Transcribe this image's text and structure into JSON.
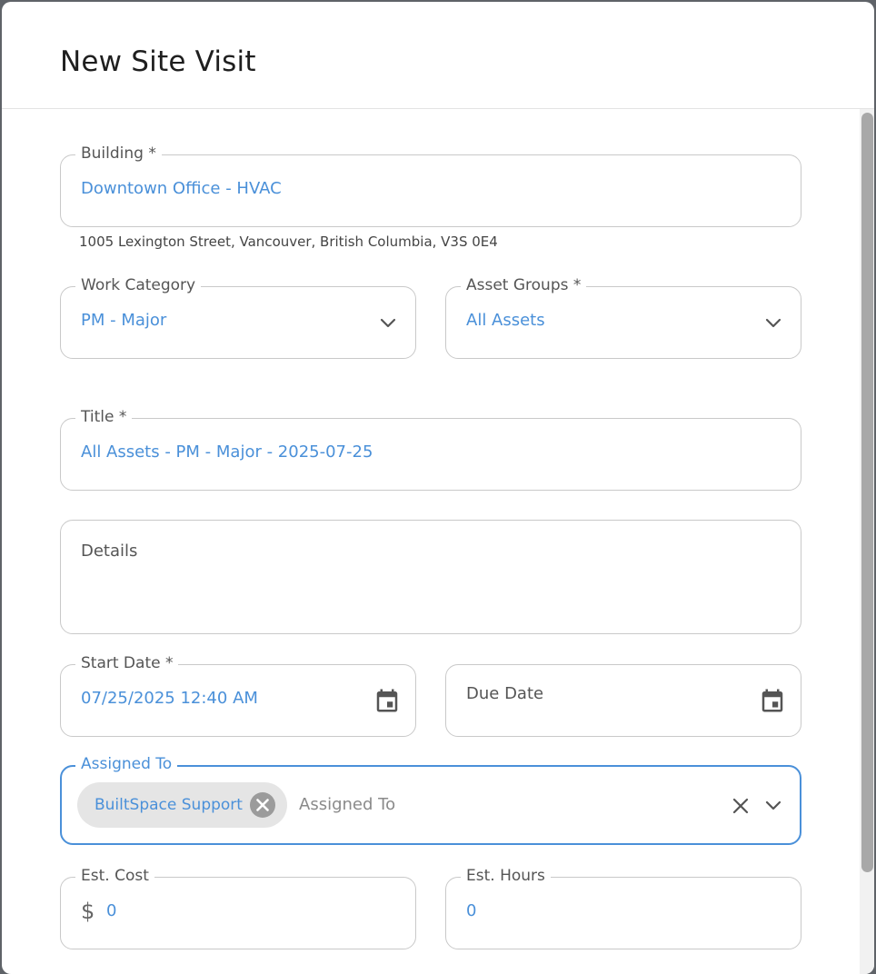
{
  "dialog": {
    "title": "New Site Visit"
  },
  "form": {
    "building": {
      "label": "Building *",
      "value": "Downtown Office - HVAC",
      "address": "1005 Lexington Street, Vancouver, British Columbia, V3S 0E4"
    },
    "work_category": {
      "label": "Work Category",
      "value": "PM - Major"
    },
    "asset_groups": {
      "label": "Asset Groups *",
      "value": "All Assets"
    },
    "title": {
      "label": "Title *",
      "value": "All Assets - PM - Major - 2025-07-25"
    },
    "details": {
      "label": "Details"
    },
    "start_date": {
      "label": "Start Date *",
      "value": "07/25/2025 12:40 AM"
    },
    "due_date": {
      "label": "Due Date"
    },
    "assigned_to": {
      "label": "Assigned To",
      "chip": "BuiltSpace Support",
      "placeholder": "Assigned To"
    },
    "est_cost": {
      "label": "Est. Cost",
      "currency_symbol": "$",
      "value": "0"
    },
    "est_hours": {
      "label": "Est. Hours",
      "value": "0"
    }
  },
  "icons": {
    "dropdown": "chevron-down-icon",
    "calendar": "calendar-icon",
    "clear": "close-icon",
    "chip_remove": "cancel-circle-icon"
  },
  "colors": {
    "accent": "#4a90d9",
    "label": "#555555",
    "border": "#c9c9c9",
    "chip_bg": "#e5e5e5"
  }
}
